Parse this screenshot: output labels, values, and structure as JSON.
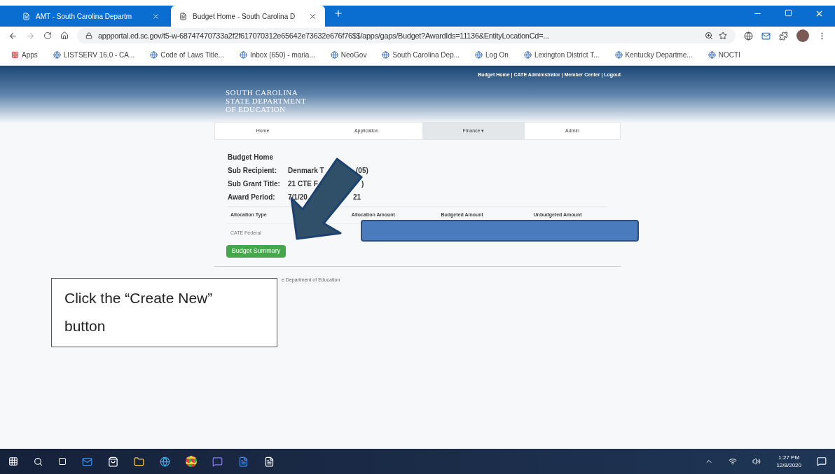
{
  "browser": {
    "tabs": [
      {
        "title": "AMT - South Carolina Departm",
        "selected": false
      },
      {
        "title": "Budget Home - South Carolina D",
        "selected": true
      }
    ],
    "url": "appportal.ed.sc.gov/t5-w-68747470733a2f2f617070312e65642e73632e676f76$$/apps/gaps/Budget?AwardIds=11136&EntityLocationCd=...",
    "bookmarks": [
      "Apps",
      "LISTSERV 16.0 - CA...",
      "Code of Laws Title...",
      "Inbox (650) - maria...",
      "NeoGov",
      "South Carolina Dep...",
      "Log On",
      "Lexington District T...",
      "Kentucky Departme...",
      "NOCTI"
    ]
  },
  "header": {
    "logo": [
      "SOUTH CAROLINA",
      "STATE DEPARTMENT",
      "OF EDUCATION"
    ],
    "links": "Budget Home | CATE Administrator | Member Center | Logout"
  },
  "nav": [
    {
      "label": "Home",
      "selected": false
    },
    {
      "label": "Application",
      "selected": false
    },
    {
      "label": "Finance ▾",
      "selected": true
    },
    {
      "label": "Admin",
      "selected": false
    }
  ],
  "budget": {
    "title": "Budget Home",
    "fields": [
      {
        "label": "Sub Recipient:",
        "value_start": "Denmark T",
        "value_end": "(05)"
      },
      {
        "label": "Sub Grant Title:",
        "value_start": "21 CTE F",
        "value_end": ")"
      },
      {
        "label": "Award Period:",
        "value_start": "7/1/20",
        "value_end": "21"
      }
    ],
    "table": {
      "columns": [
        "Allocation Type",
        "Allocation Amount",
        "Budgeted Amount",
        "Unbudgeted Amount"
      ],
      "rows": [
        [
          "CATE Federal"
        ]
      ]
    },
    "button": "Budget Summary"
  },
  "footer": "e Department of Education",
  "callout": "Click the “Create New” button",
  "taskbar": {
    "time": "1:27 PM",
    "date": "12/8/2020"
  }
}
